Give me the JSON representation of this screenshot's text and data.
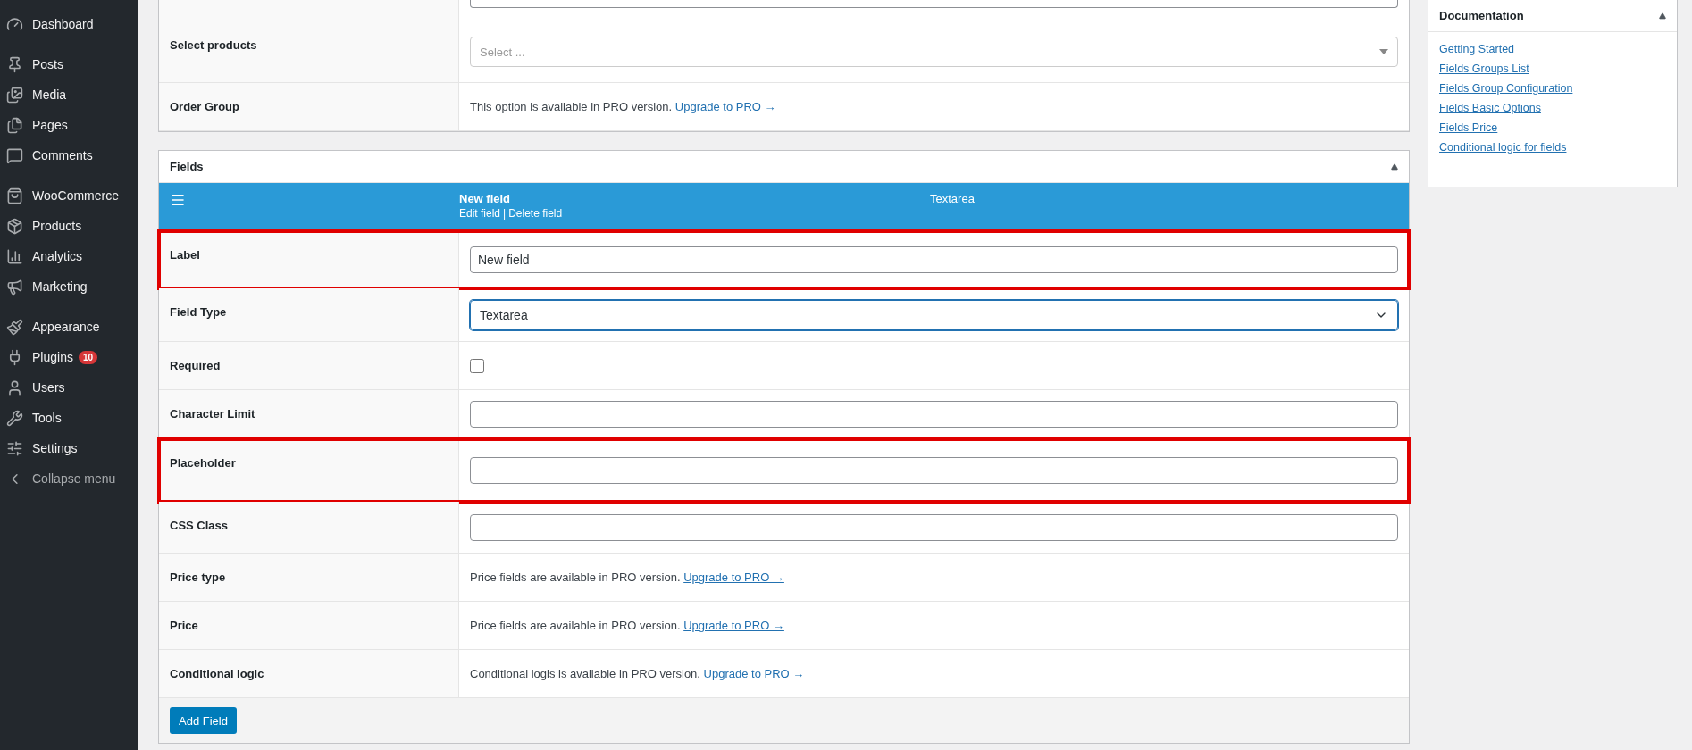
{
  "sidebar": {
    "groups": [
      {
        "items": [
          {
            "label": "Dashboard"
          }
        ]
      },
      {
        "items": [
          {
            "label": "Posts"
          },
          {
            "label": "Media"
          },
          {
            "label": "Pages"
          },
          {
            "label": "Comments"
          }
        ]
      },
      {
        "items": [
          {
            "label": "WooCommerce"
          },
          {
            "label": "Products"
          },
          {
            "label": "Analytics"
          },
          {
            "label": "Marketing"
          }
        ]
      },
      {
        "items": [
          {
            "label": "Appearance"
          },
          {
            "label": "Plugins",
            "badge": "10"
          },
          {
            "label": "Users"
          },
          {
            "label": "Tools"
          },
          {
            "label": "Settings"
          },
          {
            "label": "Collapse menu",
            "muted": true
          }
        ]
      }
    ]
  },
  "settings_table": {
    "rows": [
      {
        "label": "Select products",
        "kind": "select",
        "placeholder": "Select ..."
      },
      {
        "label": "Order Group",
        "kind": "pro",
        "message": "This option is available in PRO version.",
        "link": "Upgrade to PRO →"
      }
    ]
  },
  "fields_box": {
    "title": "Fields",
    "field_header": {
      "name": "New field",
      "actions": [
        {
          "label": "Edit field"
        },
        {
          "label": "Delete field"
        }
      ],
      "separator": "|",
      "type": "Textarea"
    },
    "rows": [
      {
        "label": "Label",
        "kind": "text",
        "value": "New field",
        "highlighted": true
      },
      {
        "label": "Field Type",
        "kind": "dropdown",
        "value": "Textarea",
        "focused": true,
        "highlighted": false
      },
      {
        "label": "Required",
        "kind": "checkbox",
        "checked": false,
        "highlighted": false
      },
      {
        "label": "Character Limit",
        "kind": "text",
        "value": "",
        "highlighted": false
      },
      {
        "label": "Placeholder",
        "kind": "text",
        "value": "",
        "highlighted": true
      },
      {
        "label": "CSS Class",
        "kind": "text",
        "value": "",
        "highlighted": false
      },
      {
        "label": "Price type",
        "kind": "pro",
        "message": "Price fields are available in PRO version.",
        "link": "Upgrade to PRO →",
        "highlighted": false
      },
      {
        "label": "Price",
        "kind": "pro",
        "message": "Price fields are available in PRO version.",
        "link": "Upgrade to PRO →",
        "highlighted": false
      },
      {
        "label": "Conditional logic",
        "kind": "pro",
        "message": "Conditional logis is available in PRO version.",
        "link": "Upgrade to PRO →",
        "highlighted": false
      }
    ],
    "add_button": "Add Field"
  },
  "documentation": {
    "title": "Documentation",
    "links": [
      "Getting Started",
      "Fields Groups List",
      "Fields Group Configuration",
      "Fields Basic Options",
      "Fields Price",
      "Conditional logic for fields"
    ]
  }
}
